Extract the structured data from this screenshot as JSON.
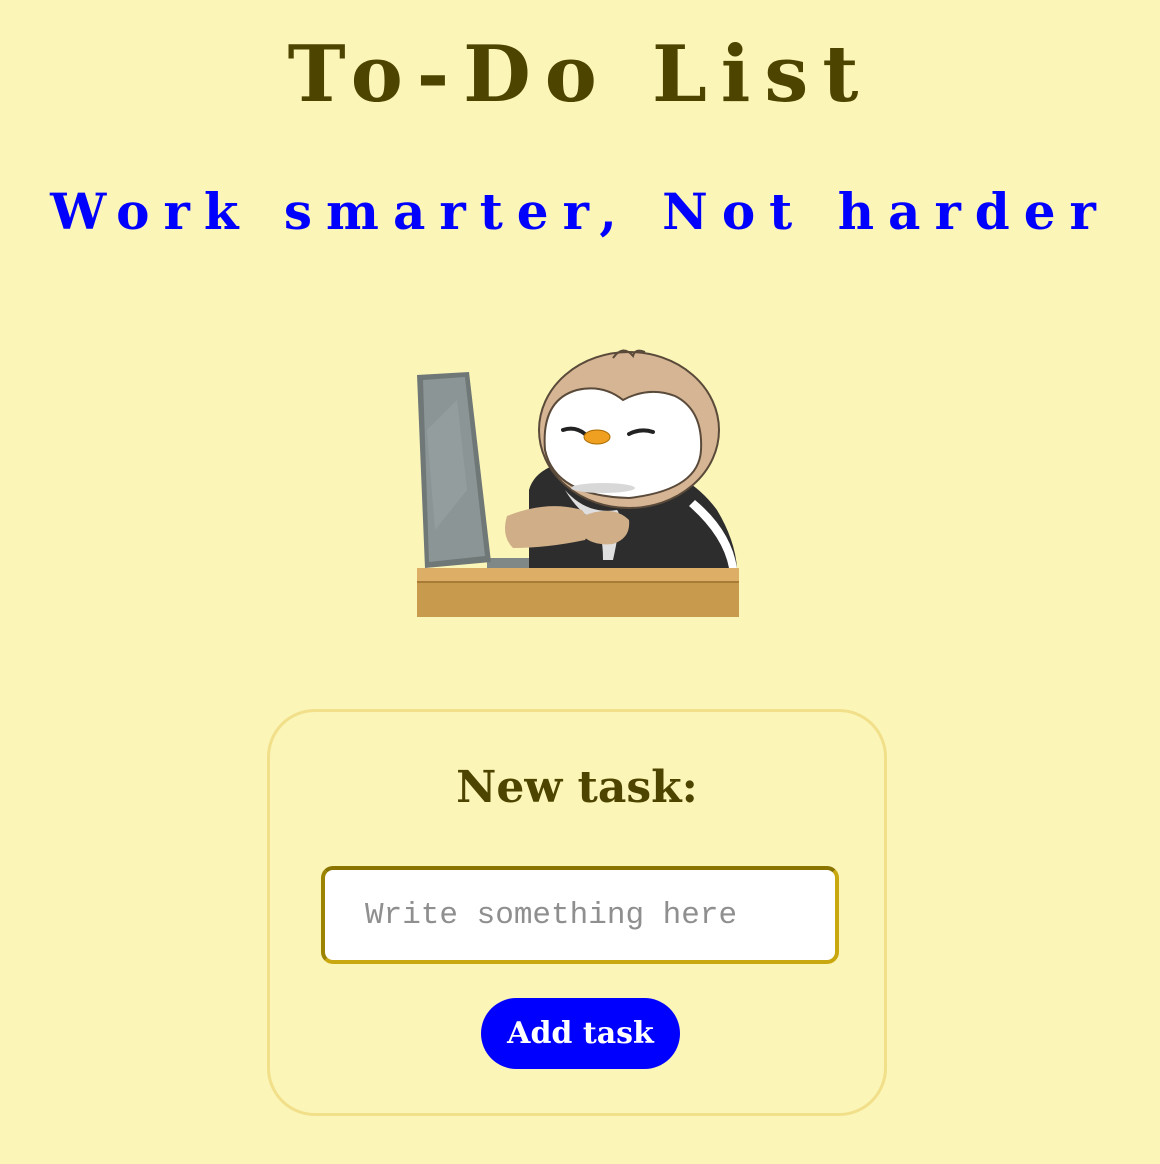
{
  "header": {
    "title": "To-Do List",
    "subtitle": "Work smarter, Not harder"
  },
  "illustration": {
    "subject": "penguin-working-at-laptop"
  },
  "form": {
    "heading": "New task:",
    "input_value": "",
    "input_placeholder": "Write something here",
    "add_button_label": "Add task"
  },
  "colors": {
    "background": "#fbf5b7",
    "title": "#4d4400",
    "accent": "#0000ff",
    "card_border": "#f1df8a",
    "input_border": "#c9a80f"
  }
}
